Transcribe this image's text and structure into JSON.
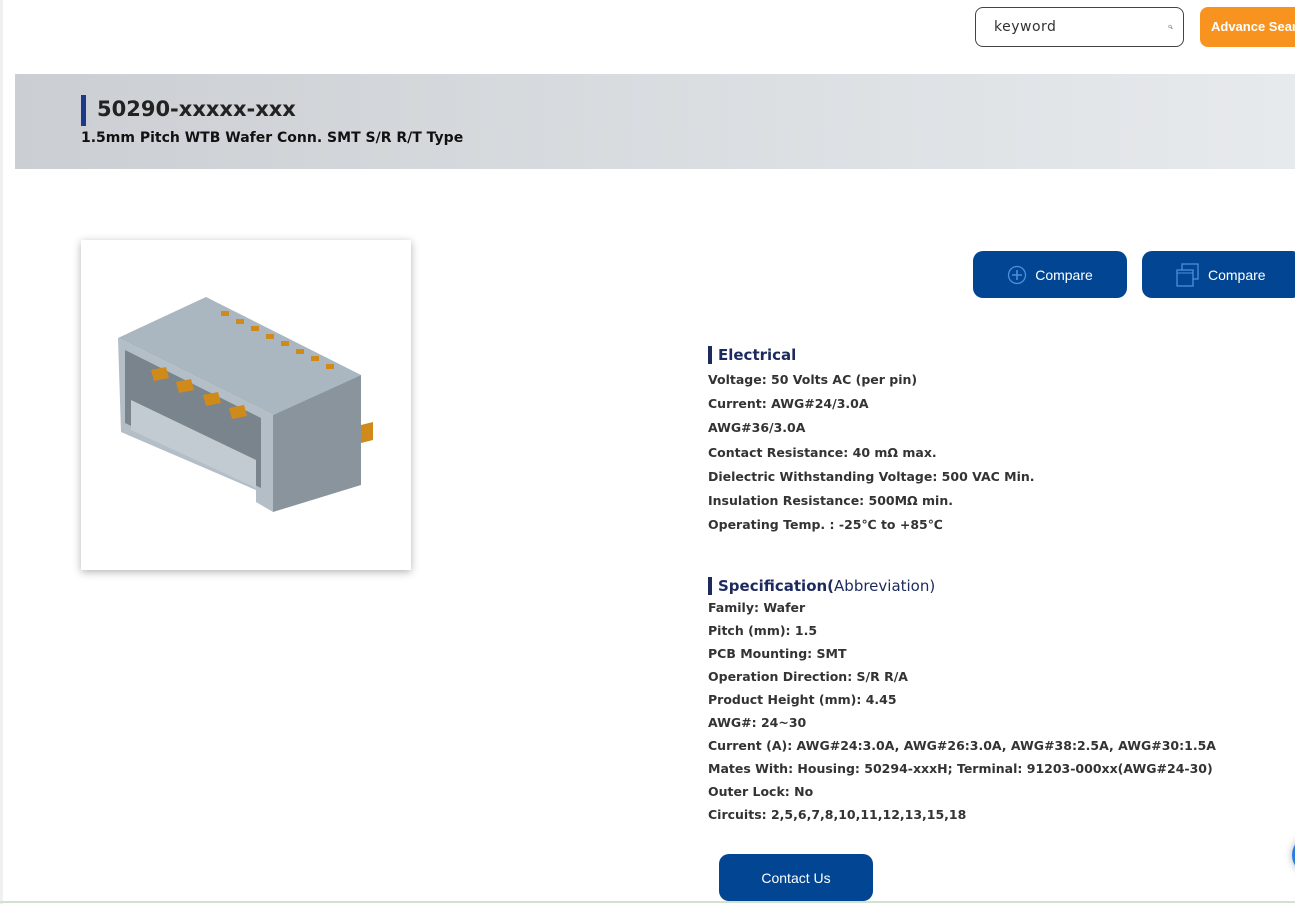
{
  "search": {
    "placeholder": "keyword",
    "advance_label": "Advance Search"
  },
  "product": {
    "title": "50290-xxxxx-xxx",
    "subtitle": "1.5mm Pitch WTB Wafer Conn. SMT S/R R/T Type"
  },
  "actions": {
    "compare_add": "Compare",
    "compare_view": "Compare",
    "contact": "Contact Us"
  },
  "electrical": {
    "heading": "Electrical",
    "lines": [
      "Voltage: 50 Volts AC (per pin)",
      "Current: AWG#24/3.0A",
      "AWG#36/3.0A",
      "Contact Resistance: 40 mΩ max.",
      "Dielectric Withstanding Voltage: 500 VAC Min.",
      "Insulation Resistance: 500MΩ min.",
      "Operating Temp. : -25℃ to +85℃"
    ]
  },
  "specification": {
    "heading": "Specification(",
    "abbr": " Abbreviation)",
    "lines": [
      "Family: Wafer",
      "Pitch (mm): 1.5",
      "PCB Mounting: SMT",
      "Operation Direction: S/R R/A",
      "Product Height (mm): 4.45",
      "AWG#: 24~30",
      "Current (A): AWG#24:3.0A, AWG#26:3.0A, AWG#38:2.5A, AWG#30:1.5A",
      "Mates With: Housing: 50294-xxxH; Terminal: 91203-000xx(AWG#24-30)",
      "Outer Lock: No",
      "Circuits: 2,5,6,7,8,10,11,12,13,15,18"
    ]
  },
  "colors": {
    "primary": "#024693",
    "accent": "#f7931e",
    "heading": "#1d2a5e"
  }
}
